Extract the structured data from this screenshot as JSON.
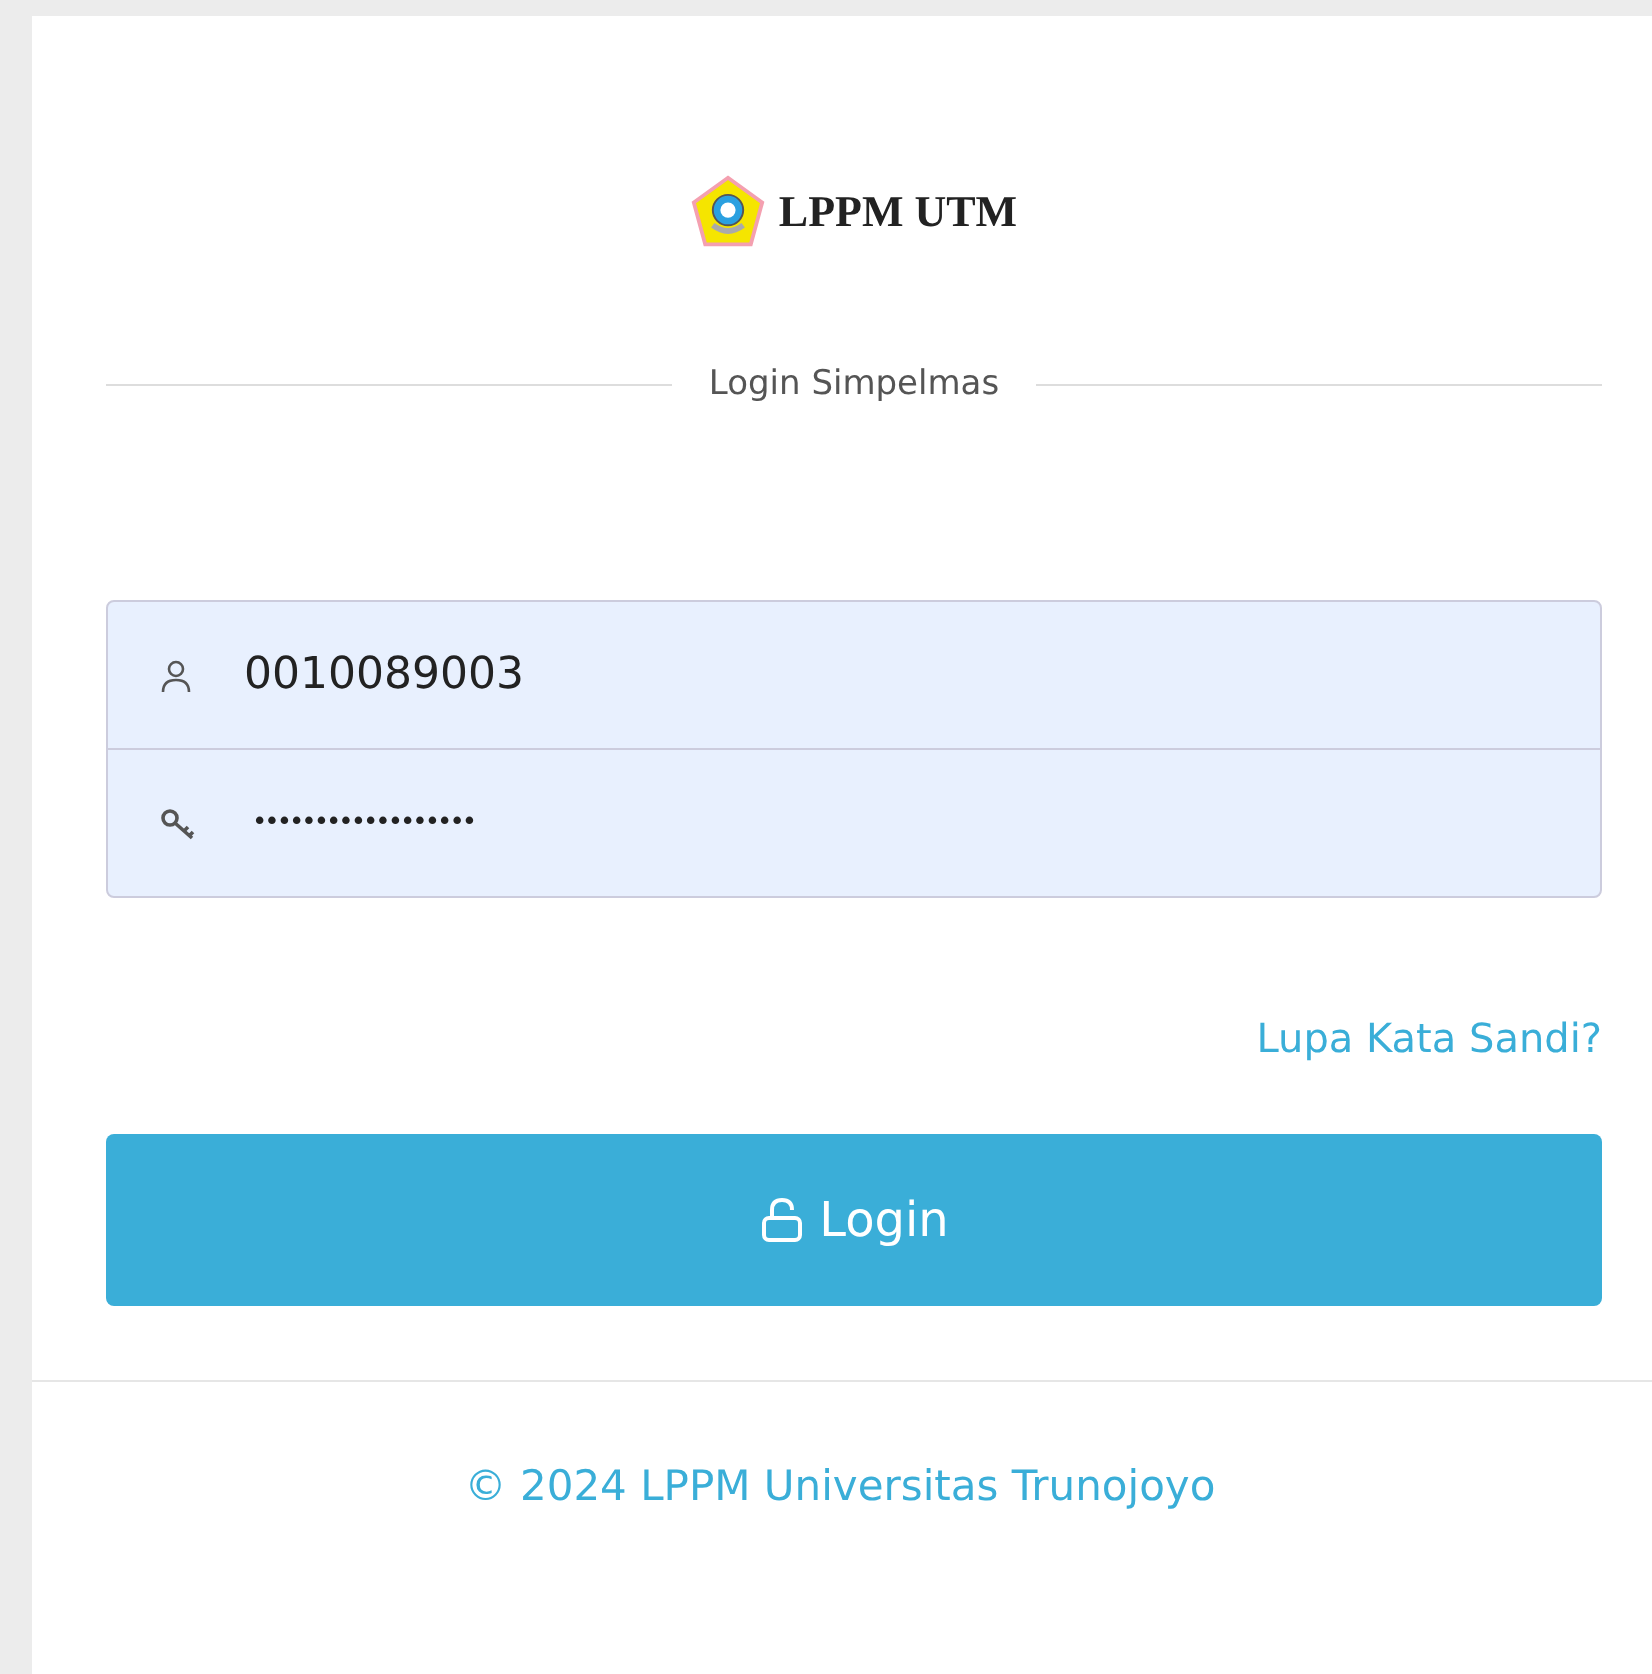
{
  "logo": {
    "text": "LPPM UTM"
  },
  "heading": "Login Simpelmas",
  "username": {
    "value": "0010089003"
  },
  "password": {
    "value": "••••••••••••••••••"
  },
  "forgot_link": "Lupa Kata Sandi?",
  "login_button": "Login",
  "footer": "© 2024 LPPM Universitas Trunojoyo"
}
